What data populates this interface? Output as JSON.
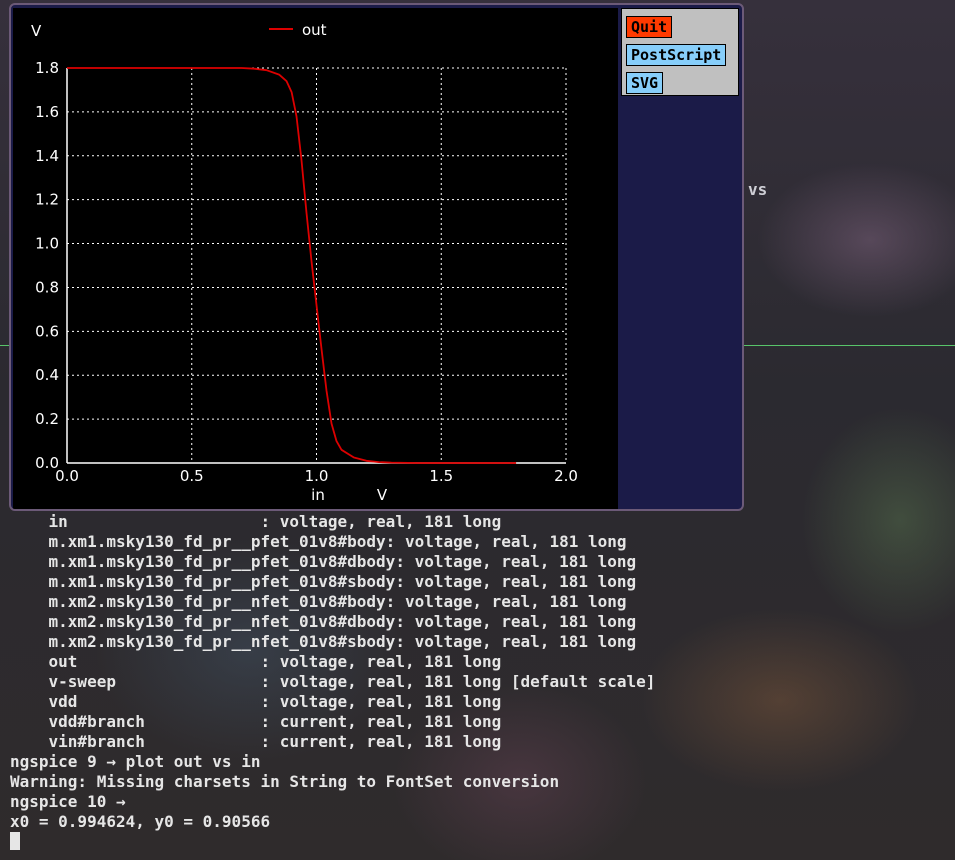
{
  "colors": {
    "plot_bg": "#000000",
    "trace": "#dd0000",
    "grid": "#ffffff",
    "axis_text": "#ffffff",
    "quit_button": "#ff3a00",
    "export_buttons": "#87cefa",
    "terminal_text": "#e6e6e6"
  },
  "background": {
    "fragment_text": "vs"
  },
  "buttons": {
    "quit": "Quit",
    "postscript": "PostScript",
    "svg": "SVG"
  },
  "chart_data": {
    "type": "line",
    "title": "",
    "xlabel": "in",
    "xunit": "V",
    "ylabel": "V",
    "xlim": [
      0.0,
      2.0
    ],
    "ylim": [
      0.0,
      1.8
    ],
    "xticks": [
      "0.0",
      "0.5",
      "1.0",
      "1.5",
      "2.0"
    ],
    "yticks": [
      "0.0",
      "0.2",
      "0.4",
      "0.6",
      "0.8",
      "1.0",
      "1.2",
      "1.4",
      "1.6",
      "1.8"
    ],
    "grid": true,
    "legend": "top-center",
    "series": [
      {
        "name": "out",
        "x": [
          0.0,
          0.5,
          0.7,
          0.75,
          0.8,
          0.85,
          0.88,
          0.9,
          0.92,
          0.94,
          0.96,
          0.98,
          1.0,
          1.02,
          1.04,
          1.06,
          1.08,
          1.1,
          1.15,
          1.2,
          1.25,
          1.3,
          1.4,
          1.8
        ],
        "y": [
          1.8,
          1.8,
          1.8,
          1.797,
          1.79,
          1.77,
          1.74,
          1.69,
          1.58,
          1.38,
          1.14,
          0.92,
          0.72,
          0.52,
          0.33,
          0.18,
          0.1,
          0.06,
          0.025,
          0.01,
          0.004,
          0.002,
          0.0,
          0.0
        ]
      }
    ]
  },
  "terminal": {
    "lines": [
      "    in                    : voltage, real, 181 long",
      "    m.xm1.msky130_fd_pr__pfet_01v8#body: voltage, real, 181 long",
      "    m.xm1.msky130_fd_pr__pfet_01v8#dbody: voltage, real, 181 long",
      "    m.xm1.msky130_fd_pr__pfet_01v8#sbody: voltage, real, 181 long",
      "    m.xm2.msky130_fd_pr__nfet_01v8#body: voltage, real, 181 long",
      "    m.xm2.msky130_fd_pr__nfet_01v8#dbody: voltage, real, 181 long",
      "    m.xm2.msky130_fd_pr__nfet_01v8#sbody: voltage, real, 181 long",
      "    out                   : voltage, real, 181 long",
      "    v-sweep               : voltage, real, 181 long [default scale]",
      "    vdd                   : voltage, real, 181 long",
      "    vdd#branch            : current, real, 181 long",
      "    vin#branch            : current, real, 181 long",
      "ngspice 9 → plot out vs in",
      "Warning: Missing charsets in String to FontSet conversion",
      "ngspice 10 →",
      "x0 = 0.994624, y0 = 0.90566"
    ]
  }
}
